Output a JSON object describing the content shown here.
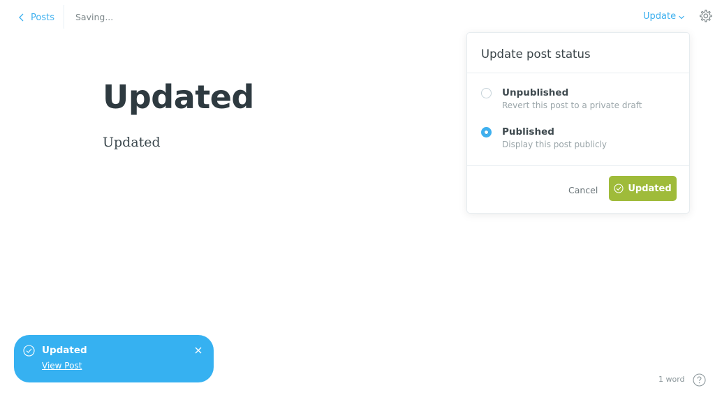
{
  "topbar": {
    "back_label": "Posts",
    "status_text": "Saving...",
    "update_label": "Update"
  },
  "editor": {
    "title": "Updated",
    "body": "Updated"
  },
  "popover": {
    "title": "Update post status",
    "options": [
      {
        "label": "Unpublished",
        "description": "Revert this post to a private draft",
        "selected": false
      },
      {
        "label": "Published",
        "description": "Display this post publicly",
        "selected": true
      }
    ],
    "cancel_label": "Cancel",
    "confirm_label": "Updated"
  },
  "toast": {
    "title": "Updated",
    "link_label": "View Post"
  },
  "footer": {
    "word_count": "1 word"
  },
  "colors": {
    "accent": "#3eb0ef",
    "confirm_button": "#9fbb3a",
    "toast_bg": "#36b1f1"
  },
  "icons": {
    "back": "chevron-left-icon",
    "update_caret": "chevron-down-icon",
    "settings": "gear-icon",
    "confirm": "check-circle-icon",
    "toast_status": "check-circle-icon",
    "toast_close": "close-icon",
    "help": "question-circle-icon"
  }
}
